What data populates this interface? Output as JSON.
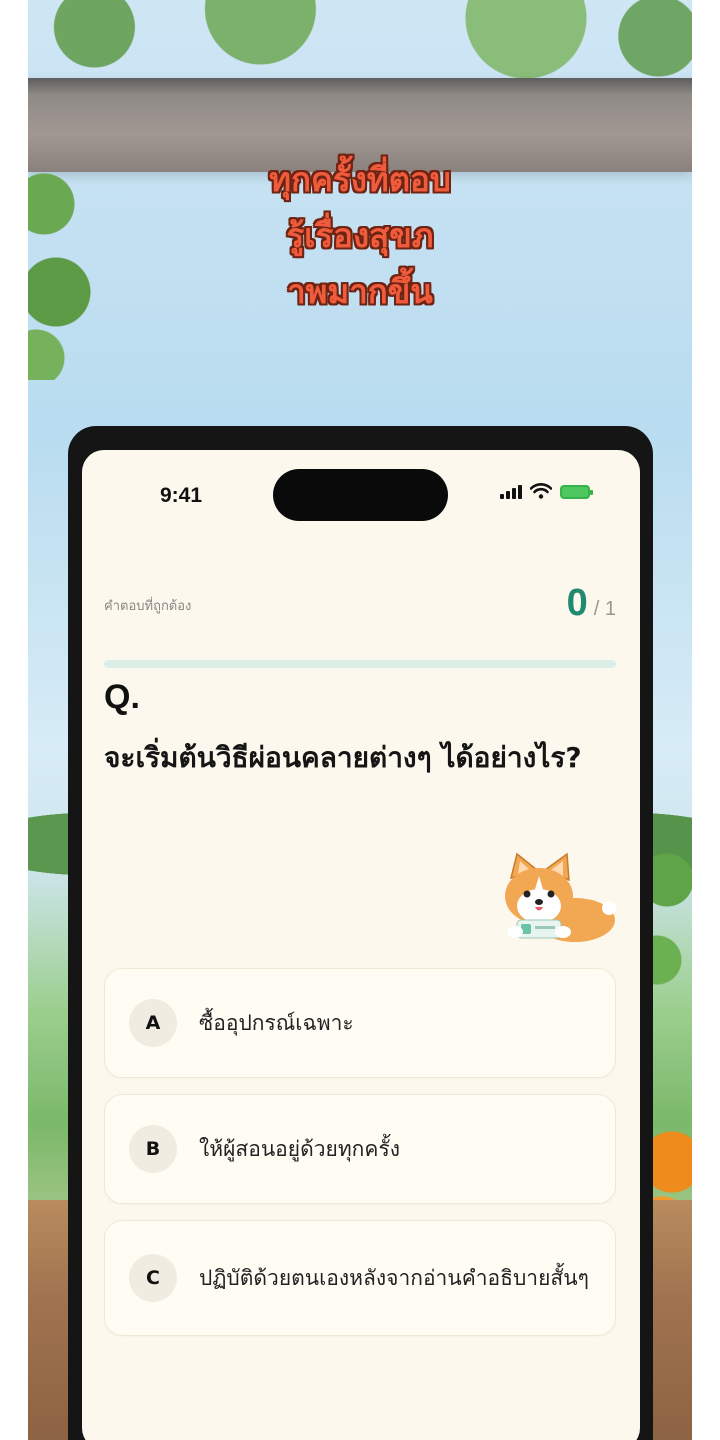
{
  "headline": {
    "lines": [
      "ทุกครั้งที่ตอบ",
      "รู้เรื่องสุขภ",
      "าพมากขึ้น"
    ]
  },
  "status_bar": {
    "time": "9:41",
    "icons": [
      "signal-icon",
      "wifi-icon",
      "battery-charging-icon"
    ]
  },
  "score": {
    "label": "คำตอบที่ถูกต้อง",
    "correct": "0",
    "total": "/ 1",
    "progress_fraction": 0
  },
  "question": {
    "mark": "Q.",
    "text": "จะเริ่มต้นวิธีผ่อนคลายต่างๆ ได้อย่างไร?"
  },
  "mascot": {
    "icon": "corgi-mascot"
  },
  "options": [
    {
      "letter": "A",
      "text": "ซื้ออุปกรณ์เฉพาะ"
    },
    {
      "letter": "B",
      "text": "ให้ผู้สอนอยู่ด้วยทุกครั้ง"
    },
    {
      "letter": "C",
      "text": "ปฏิบัติด้วยตนเองหลังจากอ่านคำอธิบายสั้นๆ"
    }
  ],
  "colors": {
    "accent": "#1f8a6f",
    "headline": "#f05b3b",
    "background": "#fdf8ee"
  }
}
